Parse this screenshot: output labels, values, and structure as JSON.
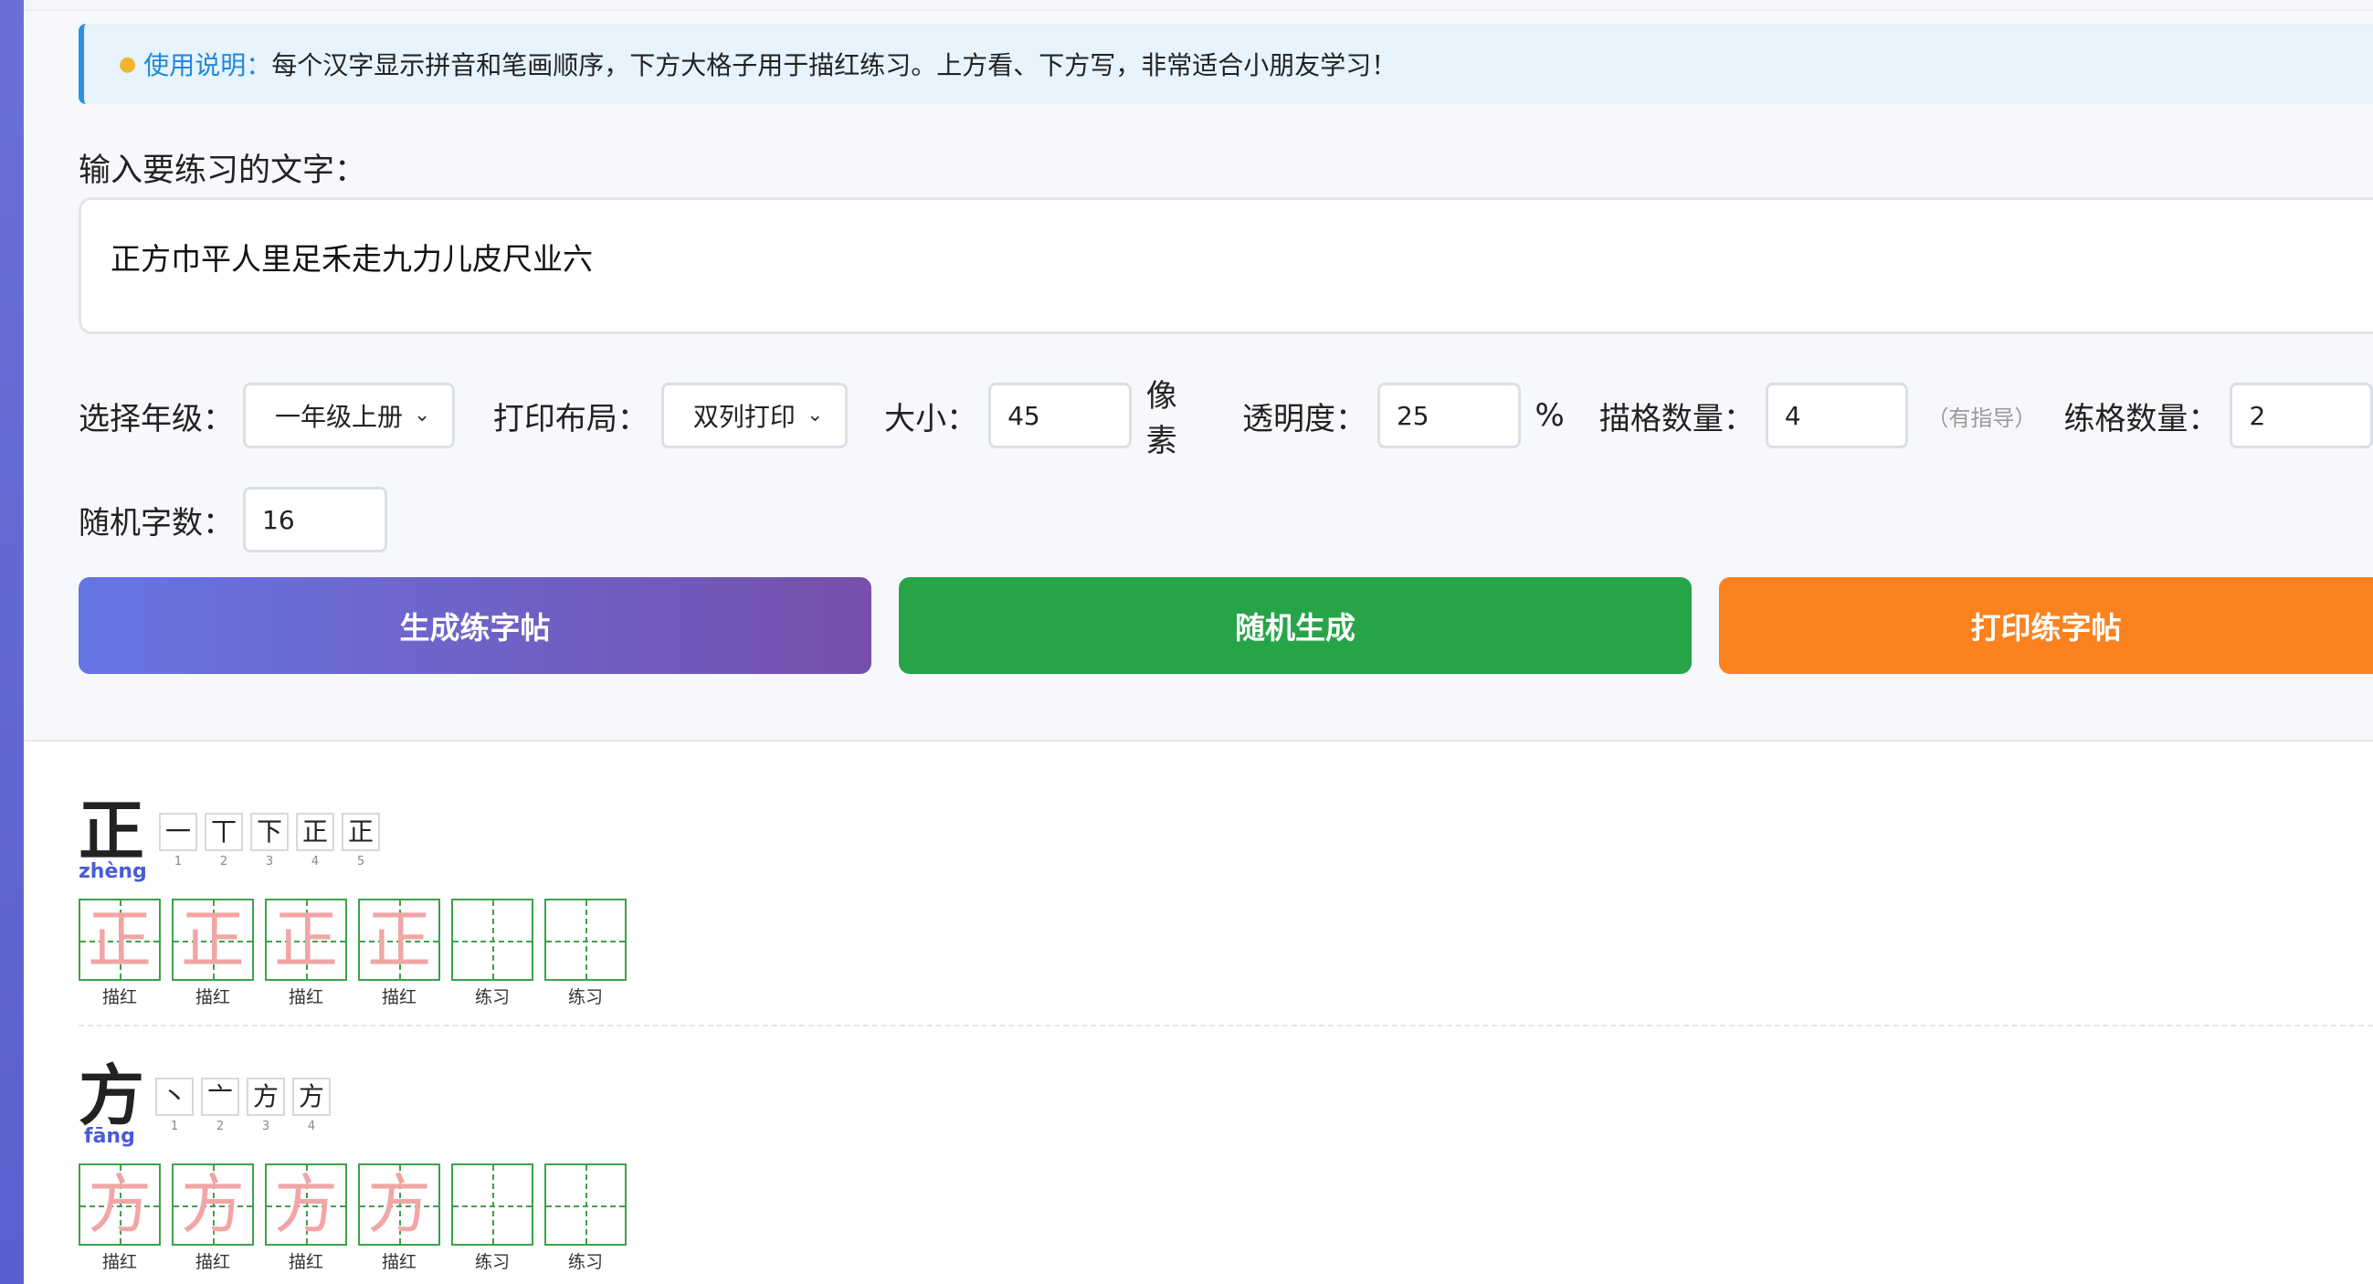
{
  "notice": {
    "icon": "bulb-icon",
    "title": "使用说明：",
    "text": "每个汉字显示拼音和笔画顺序，下方大格子用于描红练习。上方看、下方写，非常适合小朋友学习！"
  },
  "input": {
    "label": "输入要练习的文字：",
    "value": "正方巾平人里足禾走九力儿皮尺业六"
  },
  "options": {
    "grade_label": "选择年级：",
    "grade_value": "一年级上册",
    "layout_label": "打印布局：",
    "layout_value": "双列打印",
    "size_label": "大小：",
    "size_value": "45",
    "size_unit": "像素",
    "opacity_label": "透明度：",
    "opacity_value": "25",
    "opacity_unit": "%",
    "trace_label": "描格数量：",
    "trace_value": "4",
    "trace_hint": "（有指导）",
    "practice_label": "练格数量：",
    "practice_value": "2",
    "random_label": "随机字数：",
    "random_value": "16"
  },
  "buttons": {
    "generate": "生成练字帖",
    "random": "随机生成",
    "print": "打印练字帖"
  },
  "characters": [
    {
      "char": "正",
      "pinyin": "zhèng",
      "strokes": [
        "一",
        "丅",
        "下",
        "正",
        "正"
      ],
      "stroke_nums": [
        "1",
        "2",
        "3",
        "4",
        "5"
      ]
    },
    {
      "char": "方",
      "pinyin": "fāng",
      "strokes": [
        "丶",
        "亠",
        "方",
        "方"
      ],
      "stroke_nums": [
        "1",
        "2",
        "3",
        "4"
      ]
    }
  ],
  "cell_labels": {
    "trace": "描红",
    "practice": "练习"
  },
  "colors": {
    "accent": "#4a5bd6",
    "notice_border": "#2a8fe0",
    "grid_green": "#3ca24a",
    "btn_green": "#27a448",
    "btn_orange": "#fb821f",
    "ghost_red": "#f2a5a5"
  }
}
